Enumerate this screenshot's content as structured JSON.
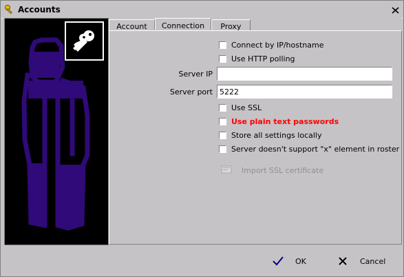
{
  "window": {
    "title": "Accounts"
  },
  "tabs": [
    {
      "label": "Account",
      "active": false
    },
    {
      "label": "Connection",
      "active": true
    },
    {
      "label": "Proxy",
      "active": false
    }
  ],
  "connection": {
    "connect_by_ip": {
      "label": "Connect by IP/hostname",
      "checked": false
    },
    "use_http_polling": {
      "label": "Use HTTP polling",
      "checked": false
    },
    "server_ip": {
      "label": "Server IP",
      "value": ""
    },
    "server_port": {
      "label": "Server port",
      "value": "5222"
    },
    "use_ssl": {
      "label": "Use SSL",
      "checked": false
    },
    "plain_text_passwords": {
      "label": "Use plain text passwords",
      "checked": false,
      "color": "#ff0000"
    },
    "store_locally": {
      "label": "Store all settings locally",
      "checked": false
    },
    "no_x_element": {
      "label": "Server doesn't support \"x\" element in roster",
      "checked": false
    },
    "import_ssl": {
      "label": "Import SSL certificate",
      "enabled": false
    }
  },
  "footer": {
    "ok_label": "OK",
    "cancel_label": "Cancel"
  },
  "icons": {
    "title": "key-icon",
    "close": "close-icon",
    "badge": "keys-icon",
    "import": "certificate-icon",
    "ok": "checkmark-icon",
    "cancel": "x-icon"
  },
  "colors": {
    "accent_purple": "#2f0a78",
    "panel_black": "#000000"
  }
}
